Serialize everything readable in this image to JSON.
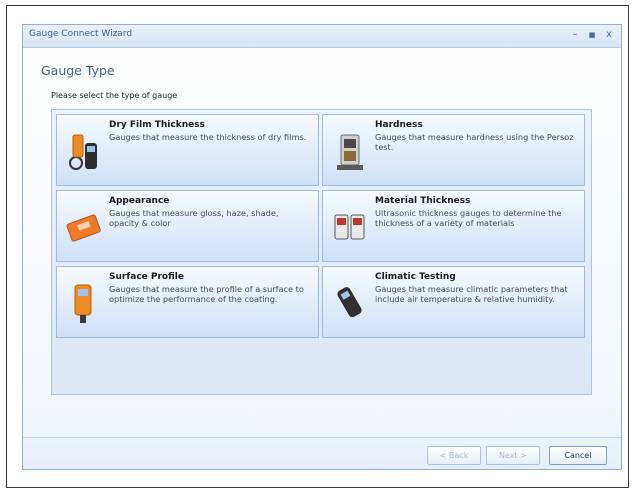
{
  "window": {
    "title": "Gauge Connect Wizard",
    "controls": {
      "minimize": "–",
      "maximize": "■",
      "close": "x"
    }
  },
  "page": {
    "title": "Gauge Type",
    "prompt": "Please select the type of gauge"
  },
  "gauge_types": [
    {
      "title": "Dry Film Thickness",
      "description": "Gauges that measure the thickness of dry films.",
      "icon": "dry-film-gauge-icon"
    },
    {
      "title": "Hardness",
      "description": "Gauges that measure hardness using the Persoz test.",
      "icon": "hardness-tester-icon"
    },
    {
      "title": "Appearance",
      "description": "Gauges that measure gloss, haze, shade, opacity & color",
      "icon": "glossmeter-icon"
    },
    {
      "title": "Material Thickness",
      "description": "Ultrasonic thickness gauges to determine the thickness of a variety of materials",
      "icon": "ultrasonic-gauge-icon"
    },
    {
      "title": "Surface Profile",
      "description": "Gauges that measure the profile of a surface to optimize the performance of the coating.",
      "icon": "surface-profile-gauge-icon"
    },
    {
      "title": "Climatic Testing",
      "description": "Gauges that measure climatic parameters that include air temperature & relative humidity.",
      "icon": "climatic-meter-icon"
    }
  ],
  "buttons": {
    "back": "< Back",
    "next": "Next >",
    "cancel": "Cancel"
  }
}
